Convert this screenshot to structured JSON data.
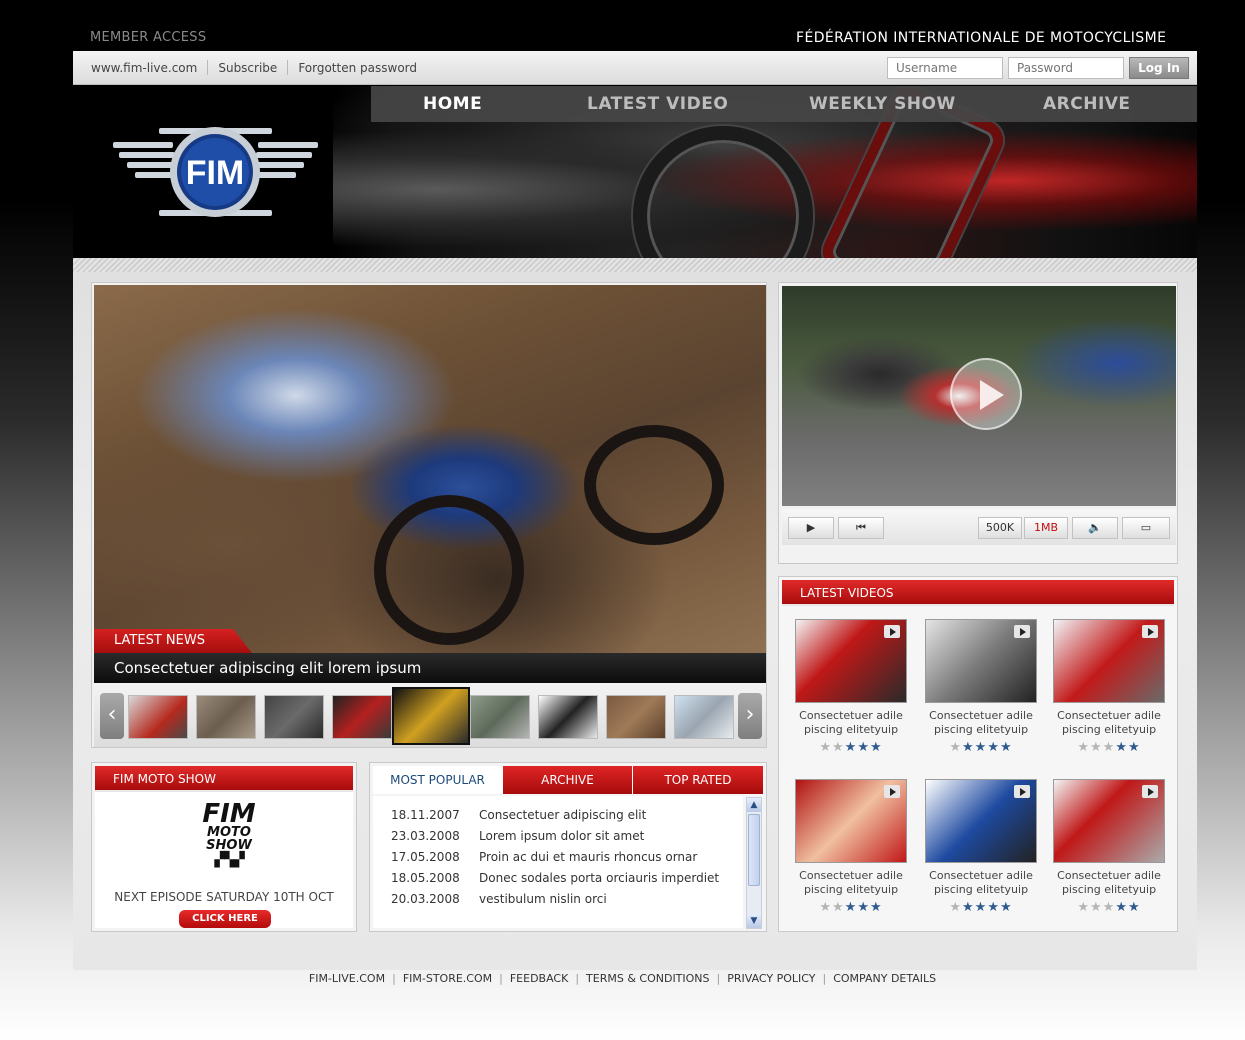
{
  "top": {
    "member_access": "MEMBER ACCESS",
    "federation": "FÉDÉRATION INTERNATIONALE DE MOTOCYCLISME"
  },
  "utility": {
    "site_link": "www.fim-live.com",
    "subscribe": "Subscribe",
    "forgotten": "Forgotten password",
    "username_placeholder": "Username",
    "password_placeholder": "Password",
    "login_label": "Log In"
  },
  "nav": {
    "items": [
      "HOME",
      "LATEST VIDEO",
      "WEEKLY SHOW",
      "ARCHIVE"
    ],
    "active": "HOME"
  },
  "logo": {
    "text": "FIM"
  },
  "hero": {
    "tab_label": "LATEST NEWS",
    "caption": "Consectetuer adipiscing elit lorem ipsum",
    "prev_arrow": "‹",
    "next_arrow": "›"
  },
  "player": {
    "controls": {
      "q1": "500K",
      "q2": "1MB"
    }
  },
  "latest_videos": {
    "header": "LATEST VIDEOS",
    "items": [
      {
        "caption": "Consectetuer adile piscing elitetyuip",
        "rating": 3
      },
      {
        "caption": "Consectetuer adile piscing elitetyuip",
        "rating": 4
      },
      {
        "caption": "Consectetuer adile piscing elitetyuip",
        "rating": 2
      },
      {
        "caption": "Consectetuer adile piscing elitetyuip",
        "rating": 3
      },
      {
        "caption": "Consectetuer adile piscing elitetyuip",
        "rating": 4
      },
      {
        "caption": "Consectetuer adile piscing elitetyuip",
        "rating": 2
      }
    ]
  },
  "moto_show": {
    "header": "FIM MOTO SHOW",
    "logo_line1": "FIM",
    "logo_line2": "MOTO",
    "logo_line3": "SHOW",
    "episode": "NEXT EPISODE SATURDAY 10TH OCT",
    "cta": "CLICK HERE"
  },
  "popular": {
    "tabs": [
      "MOST POPULAR",
      "ARCHIVE",
      "TOP RATED"
    ],
    "rows": [
      {
        "date": "18.11.2007",
        "title": "Consectetuer adipiscing elit"
      },
      {
        "date": "23.03.2008",
        "title": "Lorem ipsum dolor sit amet"
      },
      {
        "date": "17.05.2008",
        "title": "Proin ac dui et mauris rhoncus ornar"
      },
      {
        "date": "18.05.2008",
        "title": "Donec sodales porta orciauris imperdiet"
      },
      {
        "date": "20.03.2008",
        "title": "vestibulum nislin orci"
      }
    ]
  },
  "footer": {
    "links": [
      "FIM-LIVE.COM",
      "FIM-STORE.COM",
      "FEEDBACK",
      "TERMS & CONDITIONS",
      "PRIVACY POLICY",
      "COMPANY DETAILS"
    ]
  },
  "colors": {
    "accent_red": "#c81414",
    "star_on": "#2f5b8f",
    "star_off": "#b5b5b5",
    "nav_bg": "#464646"
  }
}
